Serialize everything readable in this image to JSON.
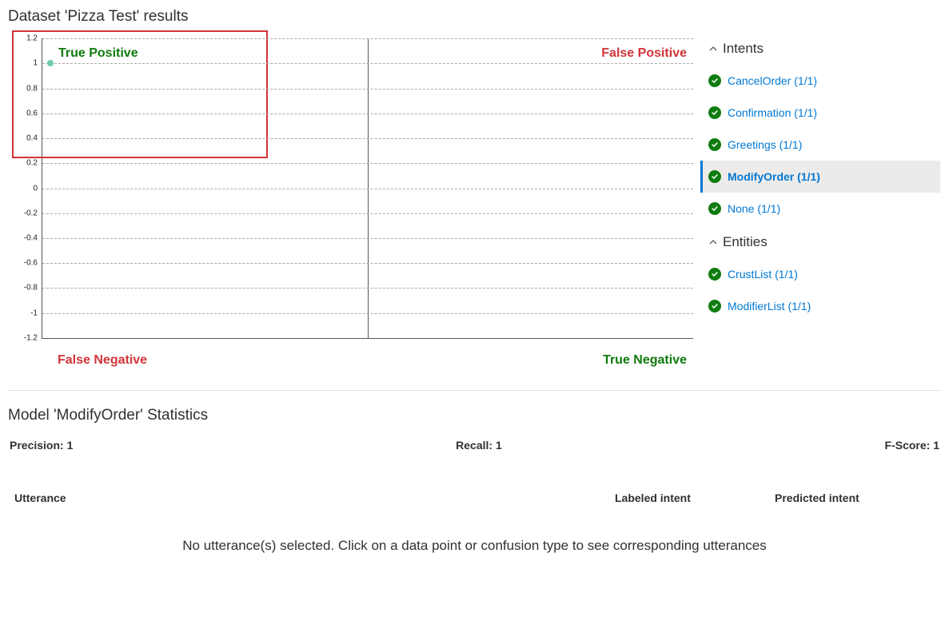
{
  "page_title": "Dataset 'Pizza Test' results",
  "chart_data": {
    "type": "scatter",
    "xlim": [
      -1,
      1
    ],
    "ylim": [
      -1.2,
      1.2
    ],
    "y_ticks": [
      1.2,
      1,
      0.8,
      0.6,
      0.4,
      0.2,
      0,
      -0.2,
      -0.4,
      -0.6,
      -0.8,
      -1,
      -1.2
    ],
    "quadrants": {
      "tp": "True Positive",
      "fp": "False Positive",
      "fn": "False Negative",
      "tn": "True Negative"
    },
    "points": [
      {
        "x": -0.975,
        "y": 1
      }
    ]
  },
  "side_panel": {
    "groups": [
      {
        "label": "Intents",
        "items": [
          {
            "label": "CancelOrder (1/1)",
            "selected": false
          },
          {
            "label": "Confirmation (1/1)",
            "selected": false
          },
          {
            "label": "Greetings (1/1)",
            "selected": false
          },
          {
            "label": "ModifyOrder (1/1)",
            "selected": true
          },
          {
            "label": "None (1/1)",
            "selected": false
          }
        ]
      },
      {
        "label": "Entities",
        "items": [
          {
            "label": "CrustList (1/1)",
            "selected": false
          },
          {
            "label": "ModifierList (1/1)",
            "selected": false
          }
        ]
      }
    ]
  },
  "stats": {
    "title": "Model 'ModifyOrder' Statistics",
    "precision_label": "Precision: 1",
    "recall_label": "Recall: 1",
    "fscore_label": "F-Score: 1"
  },
  "table": {
    "col_utterance": "Utterance",
    "col_labeled": "Labeled intent",
    "col_predicted": "Predicted intent"
  },
  "empty_message": "No utterance(s) selected. Click on a data point or confusion type to see corresponding utterances"
}
